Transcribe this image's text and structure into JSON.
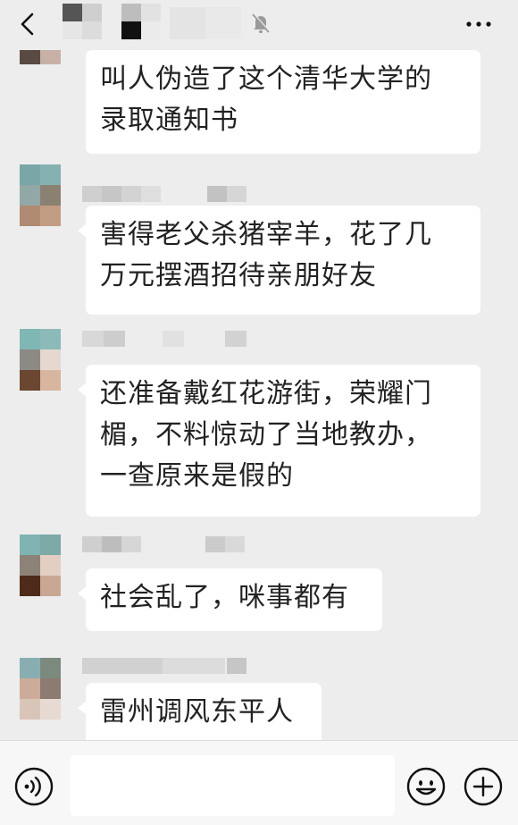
{
  "header": {
    "icons": {
      "back": "chevron-left-icon",
      "mute": "bell-off-icon",
      "more": "more-dots-icon"
    }
  },
  "messages": [
    {
      "text": "叫人伪造了这个清华大学的\n录取通知书"
    },
    {
      "text": "害得老父杀猪宰羊，花了几\n万元摆酒招待亲朋好友"
    },
    {
      "text": "还准备戴红花游街，荣耀门\n楣，不料惊动了当地教办，\n一查原来是假的"
    },
    {
      "text": "社会乱了，咪事都有"
    },
    {
      "text": "雷州调风东平人"
    }
  ],
  "composer": {
    "input_value": "",
    "icons": {
      "voice": "voice-icon",
      "emoji": "emoji-icon",
      "plus": "plus-icon"
    }
  },
  "colors": {
    "background": "#ededed",
    "bubble": "#ffffff",
    "text": "#222222"
  }
}
